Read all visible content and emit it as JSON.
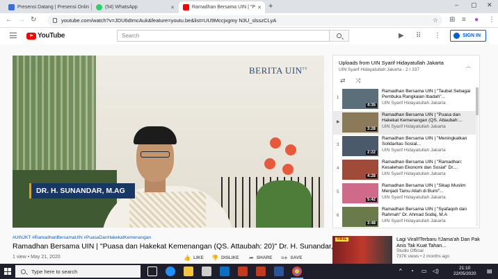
{
  "browser": {
    "tabs": [
      {
        "label": "Presensi Datang | Presensi Onlin",
        "favicon_color": "#3b6fd8",
        "active": false
      },
      {
        "label": "(54) WhatsApp",
        "favicon_color": "#25d366",
        "active": false
      },
      {
        "label": "Ramadhan Bersama UIN | \"P",
        "favicon_color": "#ff0000",
        "active": true
      }
    ],
    "url": "youtube.com/watch?v=JDU6dImcAuk&feature=youtu.be&list=UU9Mccjxgmy N3U_slsszCLyA",
    "new_tab_label": "+",
    "window_controls": [
      "–",
      "▢",
      "✕"
    ]
  },
  "youtube": {
    "logo_text": "YouTube",
    "search_placeholder": "Search",
    "sign_in_label": "SIGN IN"
  },
  "video": {
    "overlay_logo": "BERITA UIN",
    "overlay_logo_tv": "TV",
    "lower_third": "DR. H. SUNANDAR, M.AG",
    "hashtags": "#UINJKT #RamadhanBersamaUIN #PuasaDanHakekatKemenangan",
    "title": "Ramadhan Bersama UIN | \"Puasa dan Hakekat Kemenangan (QS. Attaubah: 20)\" Dr. H. Sunandar, M.Ag",
    "meta": "1 view • May 21, 2020",
    "actions": {
      "like": "LIKE",
      "dislike": "DISLIKE",
      "share": "SHARE",
      "save": "SAVE"
    }
  },
  "playlist": {
    "title": "Uploads from UIN Syarif Hidayatullah Jakarta",
    "subtitle": "UIN Syarif Hidayatullah Jakarta - 2 / 337",
    "items": [
      {
        "index": "1",
        "title": "Ramadhan Bersama UIN | \"Taubat Sebagai Pembuka Rangkaian Ibadah\"...",
        "channel": "UIN Syarif Hidayatullah Jakarta",
        "duration": "4:35",
        "thumb": "#5b6f7a",
        "active": false
      },
      {
        "index": "▶",
        "title": "Ramadhan Bersama UIN | \"Puasa dan Hakekat Kemenangan (QS. Attaubah:...",
        "channel": "UIN Syarif Hidayatullah Jakarta",
        "duration": "3:28",
        "thumb": "#8a7a5a",
        "active": true
      },
      {
        "index": "3",
        "title": "Ramadhan Bersama UIN | \"Meningkatkan Solidaritas Sosial...",
        "channel": "UIN Syarif Hidayatullah Jakarta",
        "duration": "2:22",
        "thumb": "#4a5a6a",
        "active": false
      },
      {
        "index": "4",
        "title": "Ramadhan Bersama UIN | \"Ramadhan: Kesalehan Ekonomi dan Sosial\" Dr....",
        "channel": "UIN Syarif Hidayatullah Jakarta",
        "duration": "4:28",
        "thumb": "#a04a3a",
        "active": false
      },
      {
        "index": "5",
        "title": "Ramadhan Bersama UIN | \"Sikap Muslim Menjadi Tamu Allah di Bumi\"...",
        "channel": "UIN Syarif Hidayatullah Jakarta",
        "duration": "5:42",
        "thumb": "#d06a8a",
        "active": false
      },
      {
        "index": "6",
        "title": "Ramadhan Bersama UIN | \"Syafaqoh dan Rahmah\" Dr. Ahmad Sodiq, M.A",
        "channel": "UIN Syarif Hidayatullah Jakarta",
        "duration": "3:48",
        "thumb": "#6a7a4a",
        "active": false
      }
    ]
  },
  "recommended": {
    "title": "Lagi Viral‼Terbaru ‼Jama'ah Dan Pak Anis Tak Kuat Tahan...",
    "channel": "Studio Official",
    "meta": "737K views • 2 months ago"
  },
  "taskbar": {
    "search_placeholder": "Type here to search",
    "time": "21:10",
    "date": "22/05/2020"
  }
}
